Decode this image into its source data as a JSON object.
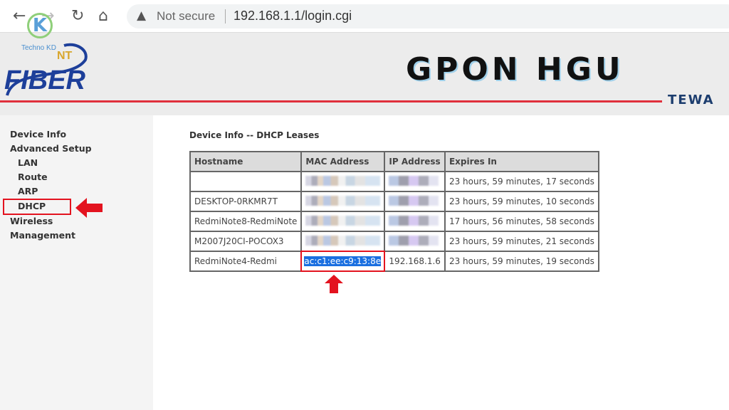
{
  "browser": {
    "back_icon": "arrow-left",
    "forward_icon": "arrow-right",
    "reload_icon": "reload",
    "home_icon": "home",
    "security_label": "Not secure",
    "url": "192.168.1.1/login.cgi"
  },
  "watermark": {
    "text": "Techno KD",
    "letter": "K"
  },
  "banner": {
    "logo_text": "FIBER",
    "logo_badge": "NT",
    "title": "GPON HGU",
    "subtitle": "TEWA",
    "accent": "#e0303c"
  },
  "sidebar": {
    "items": [
      {
        "label": "Device Info"
      },
      {
        "label": "Advanced Setup"
      },
      {
        "label": "LAN"
      },
      {
        "label": "Route"
      },
      {
        "label": "ARP"
      },
      {
        "label": "DHCP",
        "highlighted": true
      },
      {
        "label": "Wireless"
      },
      {
        "label": "Management"
      }
    ]
  },
  "main": {
    "title": "Device Info -- DHCP Leases",
    "columns": [
      "Hostname",
      "MAC Address",
      "IP Address",
      "Expires In"
    ],
    "rows": [
      {
        "hostname": "",
        "mac": "",
        "ip": "",
        "expires": "23 hours, 59 minutes, 17 seconds"
      },
      {
        "hostname": "DESKTOP-0RKMR7T",
        "mac": "",
        "ip": "",
        "expires": "23 hours, 59 minutes, 10 seconds"
      },
      {
        "hostname": "RedmiNote8-RedmiNote",
        "mac": "",
        "ip": "",
        "expires": "17 hours, 56 minutes, 58 seconds"
      },
      {
        "hostname": "M2007J20CI-POCOX3",
        "mac": "",
        "ip": "",
        "expires": "23 hours, 59 minutes, 21 seconds"
      },
      {
        "hostname": "RedmiNote4-Redmi",
        "mac": "ac:c1:ee:c9:13:8e",
        "ip": "192.168.1.6",
        "expires": "23 hours, 59 minutes, 19 seconds"
      }
    ]
  },
  "annotation_color": "#e3131f"
}
